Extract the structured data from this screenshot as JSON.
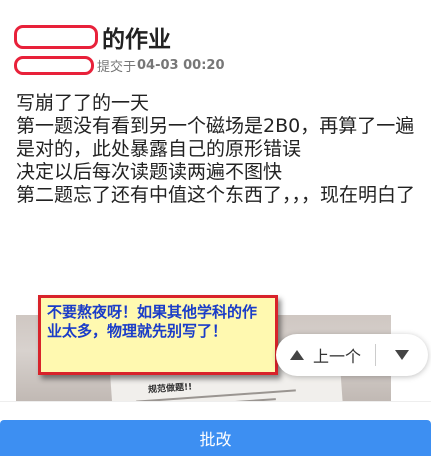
{
  "header": {
    "title_suffix": "的作业",
    "submitted_label": "提交于",
    "submitted_time": "04-03 00:20"
  },
  "content": {
    "lines": [
      "写崩了了的一天",
      "第一题没有看到另一个磁场是2B0，再算了一遍是对的，此处暴露自己的原形错误",
      "决定以后每次读题读两遍不图快",
      "第二题忘了还有中值这个东西了，，，现在明白了"
    ]
  },
  "photo": {
    "paper_title": "规范做题!!"
  },
  "comment": {
    "text": "不要熬夜呀！如果其他学科的作业太多，物理就先别写了！"
  },
  "nav": {
    "prev_label": "上一个",
    "prev_icon": "triangle-up-icon",
    "next_icon": "triangle-down-icon"
  },
  "footer": {
    "grade_label": "批改"
  },
  "colors": {
    "accent": "#3d8ff2",
    "comment_bg": "#fff9b0",
    "comment_border": "#d8232a",
    "comment_text": "#1a3cc8",
    "redaction": "#e8213a"
  }
}
